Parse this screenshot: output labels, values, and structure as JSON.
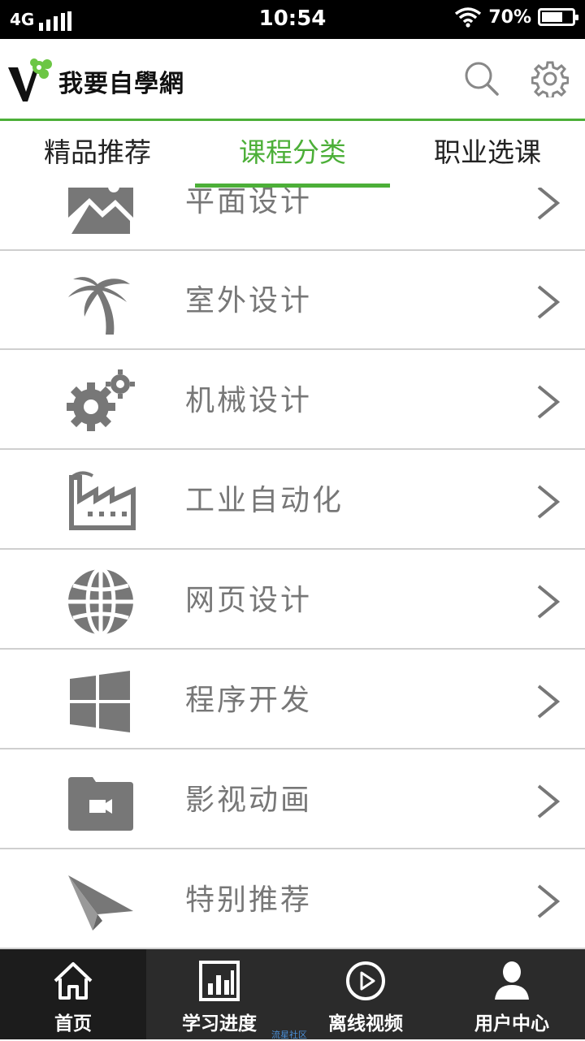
{
  "status_bar": {
    "network": "4G",
    "time": "10:54",
    "battery_text": "70%",
    "battery_level": 0.7
  },
  "header": {
    "logo_text": "我要自學網",
    "search_icon": "search-icon",
    "settings_icon": "gear-icon",
    "accent_color": "#4caf38"
  },
  "tabs": [
    {
      "label": "精品推荐",
      "active": false
    },
    {
      "label": "课程分类",
      "active": true
    },
    {
      "label": "职业选课",
      "active": false
    }
  ],
  "categories": [
    {
      "label": "平面设计",
      "icon": "image-icon"
    },
    {
      "label": "室外设计",
      "icon": "palm-tree-icon"
    },
    {
      "label": "机械设计",
      "icon": "gears-icon"
    },
    {
      "label": "工业自动化",
      "icon": "factory-icon"
    },
    {
      "label": "网页设计",
      "icon": "globe-icon"
    },
    {
      "label": "程序开发",
      "icon": "windows-icon"
    },
    {
      "label": "影视动画",
      "icon": "video-folder-icon"
    },
    {
      "label": "特别推荐",
      "icon": "paper-plane-icon"
    }
  ],
  "bottom_nav": [
    {
      "label": "首页",
      "icon": "home-icon",
      "active": true
    },
    {
      "label": "学习进度",
      "icon": "bar-chart-icon",
      "active": false
    },
    {
      "label": "离线视频",
      "icon": "play-circle-icon",
      "active": false
    },
    {
      "label": "用户中心",
      "icon": "user-icon",
      "active": false
    }
  ],
  "watermark": "流星社区"
}
